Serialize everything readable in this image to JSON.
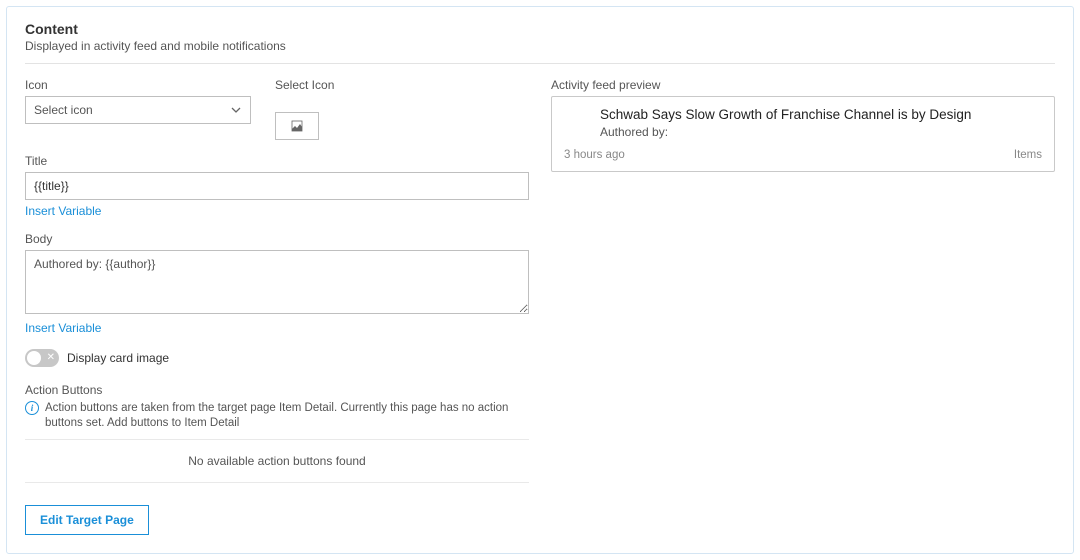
{
  "header": {
    "title": "Content",
    "subtitle": "Displayed in activity feed and mobile notifications"
  },
  "icon": {
    "label": "Icon",
    "placeholder": "Select icon",
    "select_label": "Select Icon"
  },
  "title_field": {
    "label": "Title",
    "value": "{{title}}",
    "insert_variable": "Insert Variable"
  },
  "body_field": {
    "label": "Body",
    "value": "Authored by: {{author}}",
    "insert_variable": "Insert Variable"
  },
  "toggle": {
    "label": "Display card image"
  },
  "action_buttons": {
    "label": "Action Buttons",
    "info": "Action buttons are taken from the target page Item Detail. Currently this page has no action buttons set. Add buttons to Item Detail",
    "empty": "No available action buttons found"
  },
  "edit_target_btn": "Edit Target Page",
  "preview": {
    "label": "Activity feed preview",
    "title": "Schwab Says Slow Growth of Franchise Channel is by Design",
    "body": "Authored by:",
    "timestamp": "3 hours ago",
    "category": "Items"
  }
}
